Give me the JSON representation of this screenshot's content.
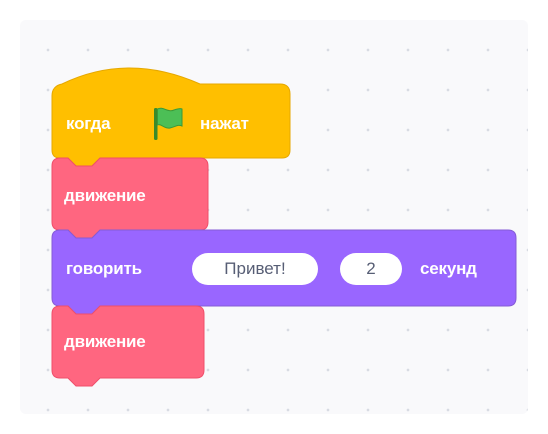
{
  "blocks": {
    "hat": {
      "label_when": "когда",
      "label_clicked": "нажат",
      "color": "#ffbf00",
      "icon": "green-flag-icon"
    },
    "motion_1": {
      "label": "движение",
      "color": "#ff6680"
    },
    "say": {
      "label_say": "говорить",
      "message": "Привет!",
      "seconds": "2",
      "label_seconds": "секунд",
      "color": "#9966ff"
    },
    "motion_2": {
      "label": "движение",
      "color": "#ff6680"
    }
  }
}
